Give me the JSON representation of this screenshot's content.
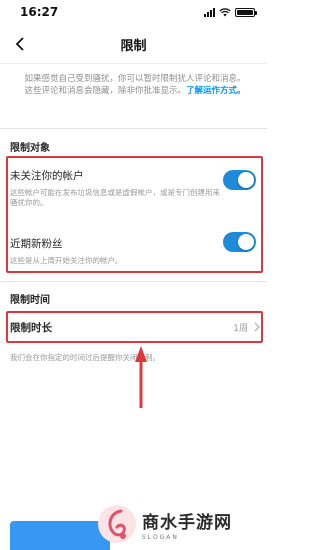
{
  "status_bar": {
    "time": "16:27"
  },
  "nav": {
    "title": "限制"
  },
  "intro": {
    "text": "如果感觉自己受到骚扰，你可以暂时限制扰人评论和消息。这些评论和消息会隐藏，除非你批准显示。",
    "link": "了解运作方式。"
  },
  "restrict_section": {
    "header": "限制对象",
    "items": [
      {
        "title": "未关注你的帐户",
        "desc": "这些帐户可能在发布垃圾信息或是虚假帐户，或是专门创建用来骚扰你的。",
        "enabled": true
      },
      {
        "title": "近期新粉丝",
        "desc": "这些是从上周开始关注你的帐户。",
        "enabled": true
      }
    ]
  },
  "time_section": {
    "header": "限制时间",
    "duration_label": "限制时长",
    "duration_value": "1周",
    "note": "我们会在你指定的时间过后提醒你关闭限制。"
  },
  "watermark": {
    "text": "商水手游网",
    "sub": "SLOGAN"
  },
  "colors": {
    "accent": "#1e8bd9",
    "highlight": "#e0373d",
    "link": "#0095f6"
  }
}
